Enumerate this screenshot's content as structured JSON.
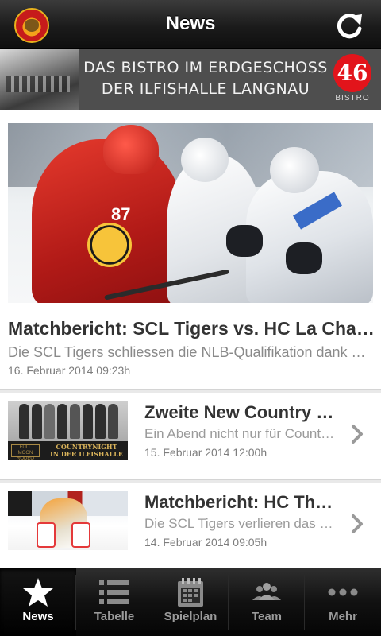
{
  "header": {
    "title": "News",
    "logo_icon": "scl-tigers-logo-icon",
    "refresh_icon": "refresh-icon"
  },
  "banner": {
    "line1": "DAS BISTRO IM ERDGESCHOSS",
    "line2": "DER ILFISHALLE LANGNAU",
    "badge": "46",
    "badge_sub": "BISTRO"
  },
  "featured": {
    "title": "Matchbericht: SCL Tigers vs. HC La Chaux-de-Fonds",
    "description": "Die SCL Tigers schliessen die NLB-Qualifikation dank einem Sieg ab",
    "date": "16. Februar 2014 09:23h",
    "player_number": "87"
  },
  "articles": [
    {
      "title": "Zweite New Country Night",
      "description": "Ein Abend nicht nur für Country-Fans",
      "date": "15. Februar 2014 12:00h",
      "thumb_caption_1": "COUNTRYNIGHT",
      "thumb_caption_2": "IN DER ILFISHALLE",
      "thumb_logo": "FULL MOON RODEO"
    },
    {
      "title": "Matchbericht: HC Thurgau vs. SCL Tigers",
      "description": "Die SCL Tigers verlieren das Spiel",
      "date": "14. Februar 2014 09:05h"
    }
  ],
  "tabs": [
    {
      "label": "News",
      "icon": "star-icon",
      "active": true
    },
    {
      "label": "Tabelle",
      "icon": "list-icon",
      "active": false
    },
    {
      "label": "Spielplan",
      "icon": "calendar-icon",
      "active": false
    },
    {
      "label": "Team",
      "icon": "team-icon",
      "active": false
    },
    {
      "label": "Mehr",
      "icon": "more-icon",
      "active": false
    }
  ],
  "colors": {
    "header_bg": "#1b1b1b",
    "accent_red": "#e2141b",
    "title_text": "#333333",
    "muted_text": "#8a8a8a"
  }
}
